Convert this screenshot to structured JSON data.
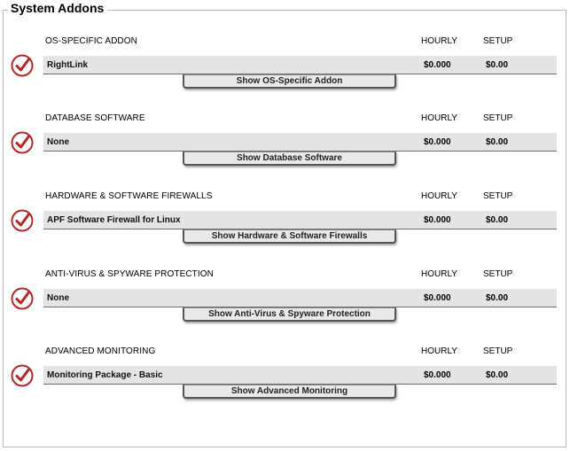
{
  "title": "System Addons",
  "columns": {
    "hourly": "HOURLY",
    "setup": "SETUP"
  },
  "sections": [
    {
      "title": "OS-SPECIFIC ADDON",
      "selected_name": "RightLink",
      "hourly": "$0.000",
      "setup": "$0.00",
      "button_label": "Show OS-Specific Addon"
    },
    {
      "title": "DATABASE SOFTWARE",
      "selected_name": "None",
      "hourly": "$0.000",
      "setup": "$0.00",
      "button_label": "Show Database Software"
    },
    {
      "title": "HARDWARE & SOFTWARE FIREWALLS",
      "selected_name": "APF Software Firewall for Linux",
      "hourly": "$0.000",
      "setup": "$0.00",
      "button_label": "Show Hardware & Software Firewalls"
    },
    {
      "title": "ANTI-VIRUS & SPYWARE PROTECTION",
      "selected_name": "None",
      "hourly": "$0.000",
      "setup": "$0.00",
      "button_label": "Show Anti-Virus & Spyware Protection"
    },
    {
      "title": "ADVANCED MONITORING",
      "selected_name": "Monitoring Package - Basic",
      "hourly": "$0.000",
      "setup": "$0.00",
      "button_label": "Show Advanced Monitoring"
    }
  ],
  "icons": {
    "selected": "check-circle-icon"
  },
  "colors": {
    "check": "#b02a2a",
    "row_background": "#e4e4e4",
    "border": "#b8b8b8"
  }
}
